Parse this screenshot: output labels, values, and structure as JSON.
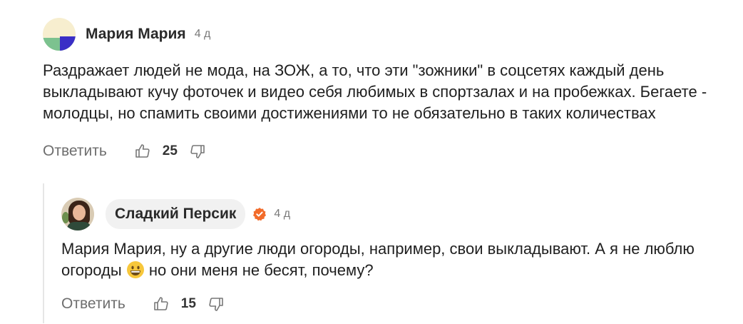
{
  "comment": {
    "author": "Мария Мария",
    "time": "4 д",
    "text": "Раздражает людей не мода, на ЗОЖ, а то, что эти \"зожники\" в соцсетях каждый день выкладывают кучу фоточек и видео себя любимых в спортзалах и на пробежках. Бегаете - молодцы, но спамить своими достижениями то не обязательно в таких количествах",
    "reply_label": "Ответить",
    "likes": "25"
  },
  "reply": {
    "author": "Сладкий Персик",
    "time": "4 д",
    "text_before": "Мария Мария, ну а другие люди огороды, например, свои выкладывают. А я не люблю огороды",
    "emoji": "grinning-face",
    "text_after": "но они меня не бесят, почему?",
    "reply_label": "Ответить",
    "likes": "15",
    "verified_color": "#f26b2a"
  },
  "icons": {
    "like": "thumbs-up-icon",
    "dislike": "thumbs-down-icon",
    "verified": "verified-badge-icon"
  }
}
